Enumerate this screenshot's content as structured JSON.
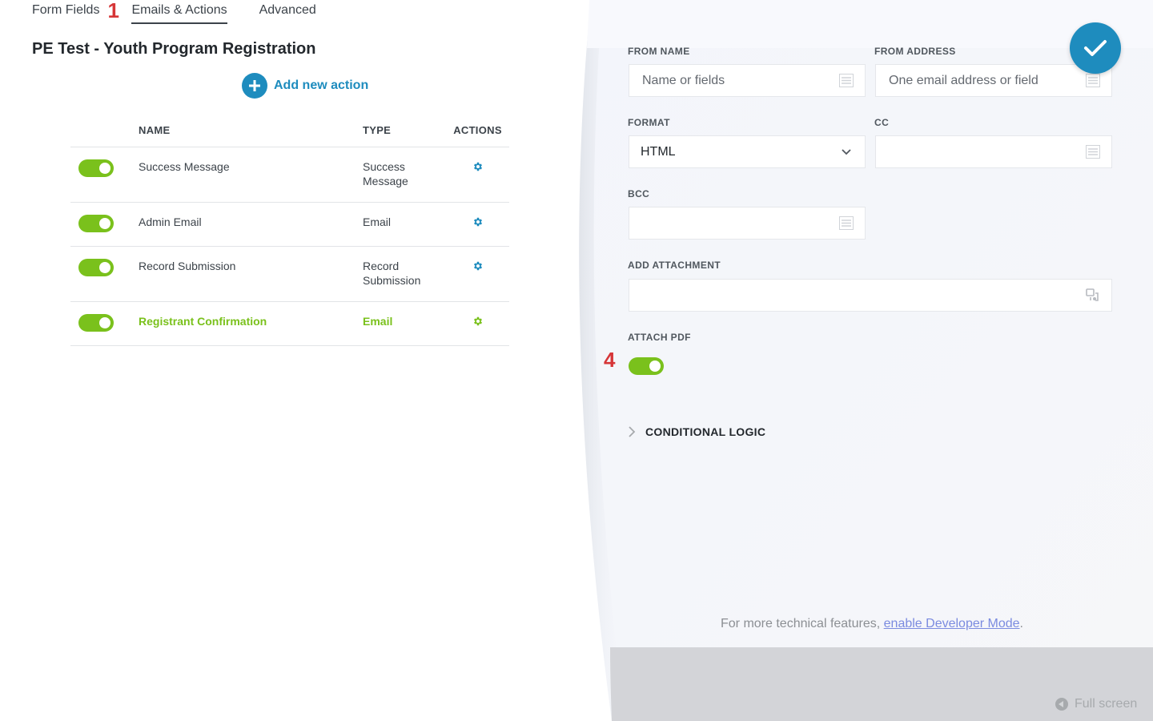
{
  "tabs": [
    {
      "label": "Form Fields"
    },
    {
      "label": "Emails & Actions",
      "marker": "1"
    },
    {
      "label": "Advanced"
    }
  ],
  "form_title": "PE Test - Youth Program Registration",
  "add_action_label": "Add new action",
  "table": {
    "headers": {
      "name": "NAME",
      "type": "TYPE",
      "actions": "ACTIONS"
    },
    "rows": [
      {
        "name": "Success Message",
        "type": "Success\nMessage",
        "enabled": true
      },
      {
        "name": "Admin Email",
        "type": "Email",
        "enabled": true
      },
      {
        "name": "Record Submission",
        "type": "Record\nSubmission",
        "enabled": true
      },
      {
        "name": "Registrant Confirmation",
        "type": "Email",
        "enabled": true,
        "highlighted": true
      }
    ]
  },
  "drawer": {
    "from_name": {
      "label": "FROM NAME",
      "placeholder": "Name or fields"
    },
    "from_address": {
      "label": "FROM ADDRESS",
      "placeholder": "One email address or field"
    },
    "format": {
      "label": "FORMAT",
      "value": "HTML"
    },
    "cc": {
      "label": "CC",
      "value": ""
    },
    "bcc": {
      "label": "BCC",
      "value": ""
    },
    "add_attachment": {
      "label": "ADD ATTACHMENT",
      "value": ""
    },
    "attach_pdf": {
      "label": "ATTACH PDF",
      "enabled": true,
      "marker": "4"
    },
    "conditional_logic_label": "CONDITIONAL LOGIC",
    "footer_prefix": "For more technical features, ",
    "footer_link": "enable Developer Mode",
    "footer_suffix": ".",
    "fullscreen_label": "Full screen"
  },
  "colors": {
    "accent": "#1e8cbe",
    "toggle_on": "#7ac11c",
    "highlight_text": "#7ac11c",
    "marker": "#d63638"
  }
}
